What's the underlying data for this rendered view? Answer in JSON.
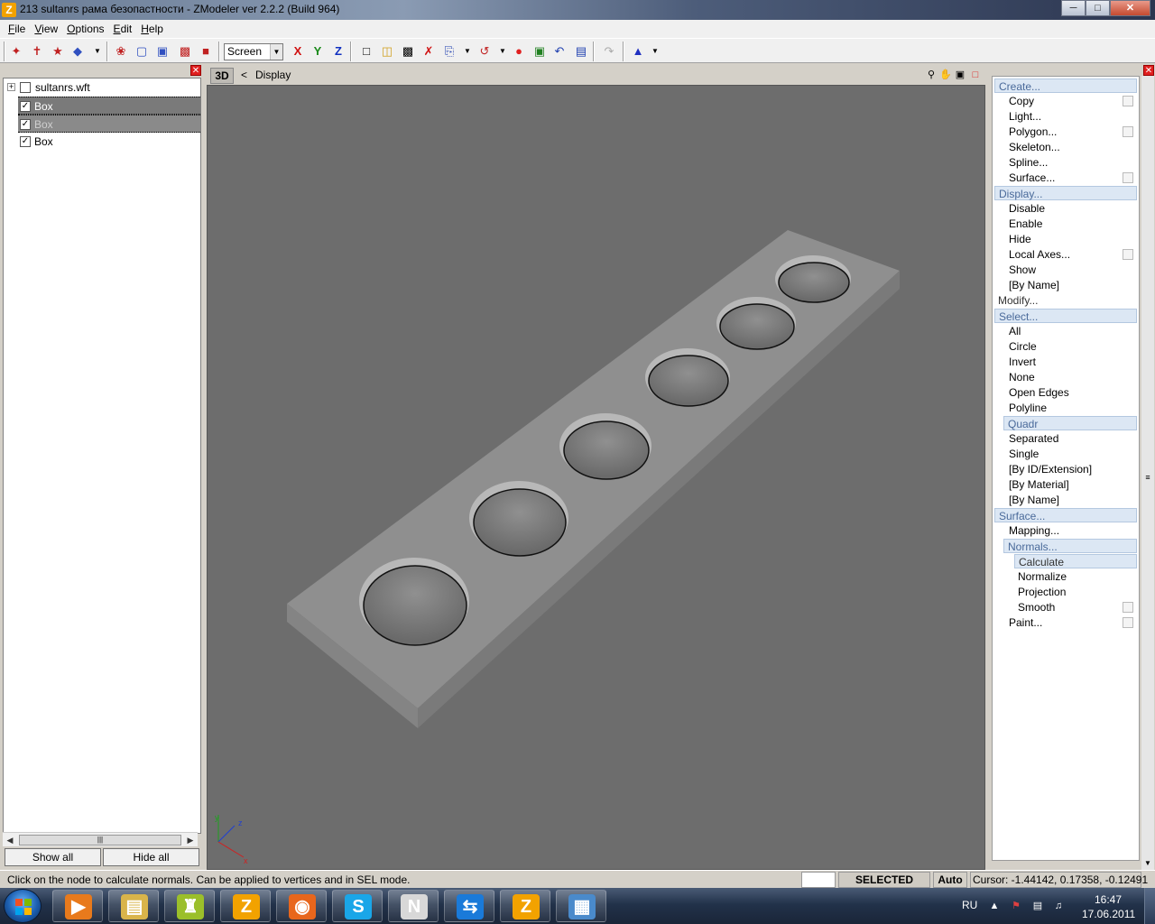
{
  "window": {
    "title": "213 sultanrs рама безопастности - ZModeler ver 2.2.2 (Build 964)",
    "app_icon": "Z",
    "buttons": [
      "minimize-icon",
      "maximize-icon",
      "close-icon"
    ]
  },
  "menu": [
    {
      "label": "File",
      "mnemonic": "F",
      "rest": "ile"
    },
    {
      "label": "View",
      "mnemonic": "V",
      "rest": "iew"
    },
    {
      "label": "Options",
      "mnemonic": "O",
      "rest": "ptions"
    },
    {
      "label": "Edit",
      "mnemonic": "E",
      "rest": "dit"
    },
    {
      "label": "Help",
      "mnemonic": "H",
      "rest": "elp"
    }
  ],
  "toolbar": {
    "view_select": "Screen",
    "axes": {
      "x": "X",
      "y": "Y",
      "z": "Z"
    },
    "colors": {
      "x": "#d01010",
      "y": "#1a8a1a",
      "z": "#1030c0"
    }
  },
  "tree": {
    "items": [
      {
        "label": "sultanrs.wft",
        "checked": false,
        "expander": "+"
      },
      {
        "label": "Box",
        "checked": true
      },
      {
        "label": "Box",
        "checked": true
      },
      {
        "label": "Box",
        "checked": true
      }
    ],
    "show_all": "Show all",
    "hide_all": "Hide all"
  },
  "viewport": {
    "mode": "3D",
    "back": "<",
    "title": "Display",
    "axes": {
      "x": "x",
      "y": "y",
      "z": "z"
    },
    "background": "#6d6d6d"
  },
  "commands": [
    {
      "label": "Create...",
      "kind": "header"
    },
    {
      "label": "Copy",
      "kind": "item",
      "box": true
    },
    {
      "label": "Light...",
      "kind": "item"
    },
    {
      "label": "Polygon...",
      "kind": "item",
      "box": true
    },
    {
      "label": "Skeleton...",
      "kind": "item"
    },
    {
      "label": "Spline...",
      "kind": "item"
    },
    {
      "label": "Surface...",
      "kind": "item",
      "box": true
    },
    {
      "label": "Display...",
      "kind": "header"
    },
    {
      "label": "Disable",
      "kind": "item"
    },
    {
      "label": "Enable",
      "kind": "item"
    },
    {
      "label": "Hide",
      "kind": "item"
    },
    {
      "label": "Local Axes...",
      "kind": "item",
      "box": true
    },
    {
      "label": "Show",
      "kind": "item"
    },
    {
      "label": "[By Name]",
      "kind": "item"
    },
    {
      "label": "Modify...",
      "kind": "top"
    },
    {
      "label": "Select...",
      "kind": "header"
    },
    {
      "label": "All",
      "kind": "item"
    },
    {
      "label": "Circle",
      "kind": "item"
    },
    {
      "label": "Invert",
      "kind": "item"
    },
    {
      "label": "None",
      "kind": "item"
    },
    {
      "label": "Open Edges",
      "kind": "item"
    },
    {
      "label": "Polyline",
      "kind": "item"
    },
    {
      "label": "Quadr",
      "kind": "subheader"
    },
    {
      "label": "Separated",
      "kind": "item"
    },
    {
      "label": "Single",
      "kind": "item"
    },
    {
      "label": "[By ID/Extension]",
      "kind": "item"
    },
    {
      "label": "[By Material]",
      "kind": "item"
    },
    {
      "label": "[By Name]",
      "kind": "item"
    },
    {
      "label": "Surface...",
      "kind": "header"
    },
    {
      "label": "Mapping...",
      "kind": "item"
    },
    {
      "label": "Normals...",
      "kind": "subheader"
    },
    {
      "label": "Calculate",
      "kind": "subitem-active"
    },
    {
      "label": "Normalize",
      "kind": "subitem"
    },
    {
      "label": "Projection",
      "kind": "subitem"
    },
    {
      "label": "Smooth",
      "kind": "subitem",
      "box": true
    },
    {
      "label": "Paint...",
      "kind": "item",
      "box": true
    }
  ],
  "status": {
    "message": "Click on the node to calculate normals. Can be applied to vertices and in SEL mode.",
    "mode": "SELECTED MODE",
    "auto": "Auto",
    "cursor": "Cursor: -1.44142, 0.17358, -0.12491"
  },
  "taskbar": {
    "apps": [
      {
        "name": "media-player-icon",
        "glyph": "▶",
        "color": "#e87a1c"
      },
      {
        "name": "file-explorer-icon",
        "glyph": "▤",
        "color": "#d9b44a"
      },
      {
        "name": "game-app-icon",
        "glyph": "♜",
        "color": "#9bbf2a"
      },
      {
        "name": "zmodeler-icon",
        "glyph": "Z",
        "color": "#f2a200"
      },
      {
        "name": "firefox-icon",
        "glyph": "◉",
        "color": "#e8661c"
      },
      {
        "name": "skype-icon",
        "glyph": "S",
        "color": "#1aa6e8"
      },
      {
        "name": "notepad-plus-icon",
        "glyph": "N",
        "color": "#d8d8d8"
      },
      {
        "name": "teamviewer-icon",
        "glyph": "⇆",
        "color": "#1a7ad9"
      },
      {
        "name": "zmodeler-active-icon",
        "glyph": "Z",
        "color": "#f2a200"
      },
      {
        "name": "photo-viewer-icon",
        "glyph": "▦",
        "color": "#4a8acb"
      }
    ],
    "lang": "RU",
    "time": "16:47",
    "date": "17.06.2011"
  }
}
